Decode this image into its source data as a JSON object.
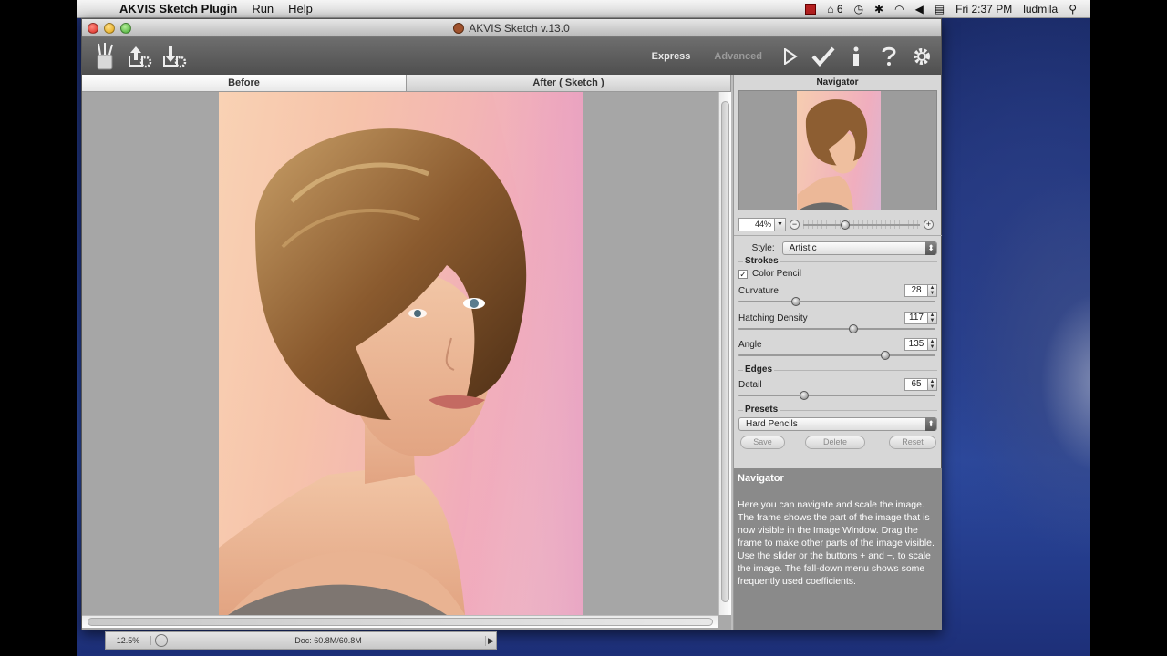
{
  "menubar": {
    "apple_glyph": "",
    "app_name": "AKVIS Sketch Plugin",
    "menus": [
      "Run",
      "Help"
    ],
    "status_items": [
      "6"
    ],
    "clock": "Fri 2:37 PM",
    "user": "ludmila"
  },
  "window": {
    "title": "AKVIS Sketch v.13.0"
  },
  "toolbar": {
    "mode_express": "Express",
    "mode_advanced": "Advanced"
  },
  "tabs": {
    "before": "Before",
    "after": "After ( Sketch )"
  },
  "navigator": {
    "title": "Navigator",
    "zoom": "44%",
    "zoom_level": 0.35
  },
  "settings": {
    "style_label": "Style:",
    "style_value": "Artistic",
    "strokes_label": "Strokes",
    "color_pencil_label": "Color Pencil",
    "color_pencil_checked": true,
    "curvature_label": "Curvature",
    "curvature_value": "28",
    "hatching_label": "Hatching Density",
    "hatching_value": "117",
    "angle_label": "Angle",
    "angle_value": "135",
    "edges_label": "Edges",
    "detail_label": "Detail",
    "detail_value": "65",
    "presets_label": "Presets",
    "preset_value": "Hard Pencils",
    "save_label": "Save",
    "delete_label": "Delete",
    "reset_label": "Reset"
  },
  "help": {
    "title": "Navigator",
    "text": "Here you can navigate and scale the image. The frame shows the part of the image that is now visible in the Image Window. Drag the frame to make other parts of the image visible. Use the slider or the buttons + and −, to scale the image. The fall-down menu shows some frequently used coefficients."
  },
  "ps_status": {
    "zoom": "12.5%",
    "doc": "Doc: 60.8M/60.8M"
  }
}
